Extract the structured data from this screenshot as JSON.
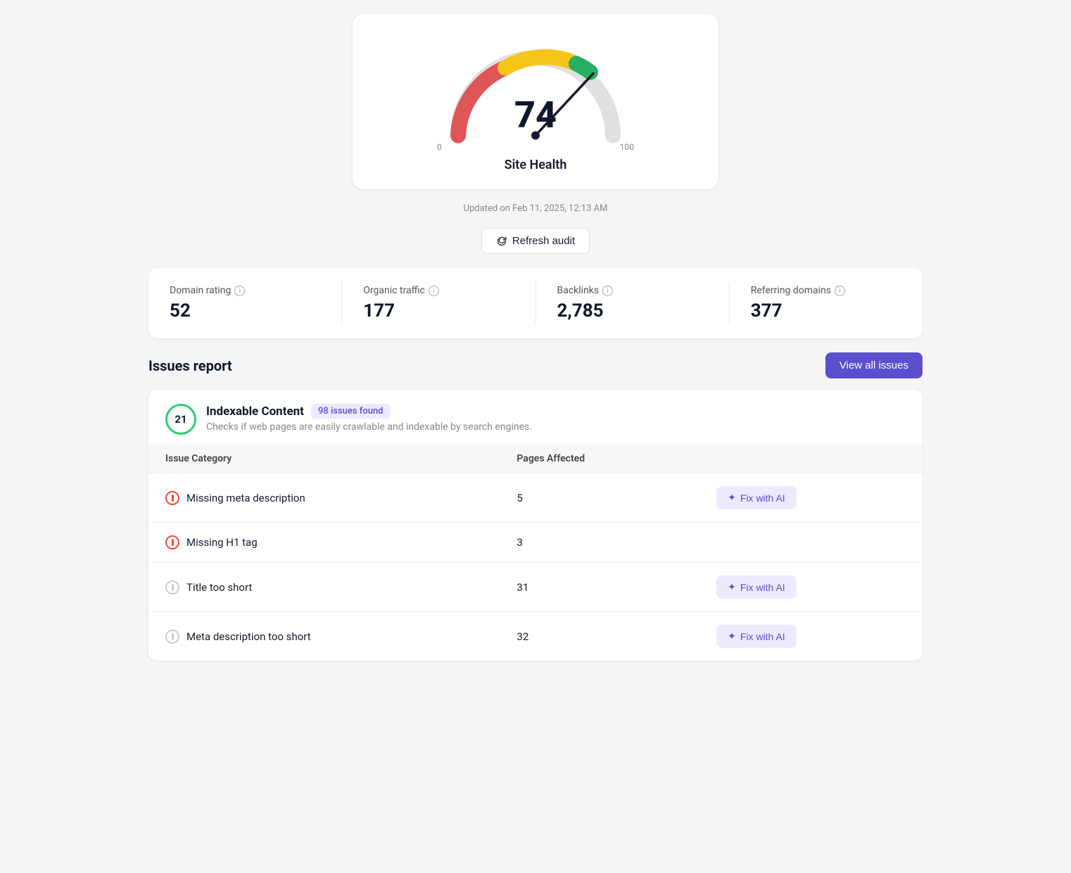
{
  "gauge": {
    "score": "74",
    "min_label": "0",
    "max_label": "100",
    "title": "Site Health",
    "updated_text": "Updated on Feb 11, 2025, 12:13 AM"
  },
  "refresh_button": {
    "label": "Refresh audit"
  },
  "stats": [
    {
      "label": "Domain rating",
      "value": "52"
    },
    {
      "label": "Organic traffic",
      "value": "177"
    },
    {
      "label": "Backlinks",
      "value": "2,785"
    },
    {
      "label": "Referring domains",
      "value": "377"
    }
  ],
  "issues_section": {
    "title": "Issues report",
    "view_all_label": "View all issues"
  },
  "indexable_content": {
    "badge_number": "21",
    "title": "Indexable Content",
    "issues_found": "98 issues found",
    "description": "Checks if web pages are easily crawlable and indexable by search engines.",
    "table": {
      "col1": "Issue Category",
      "col2": "Pages Affected",
      "rows": [
        {
          "icon_type": "error",
          "issue": "Missing meta description",
          "pages": "5",
          "has_fix": true,
          "fix_label": "Fix with AI"
        },
        {
          "icon_type": "error",
          "issue": "Missing H1 tag",
          "pages": "3",
          "has_fix": false,
          "fix_label": ""
        },
        {
          "icon_type": "warning",
          "issue": "Title too short",
          "pages": "31",
          "has_fix": true,
          "fix_label": "Fix with AI"
        },
        {
          "icon_type": "warning",
          "issue": "Meta description too short",
          "pages": "32",
          "has_fix": true,
          "fix_label": "Fix with AI"
        }
      ]
    }
  }
}
